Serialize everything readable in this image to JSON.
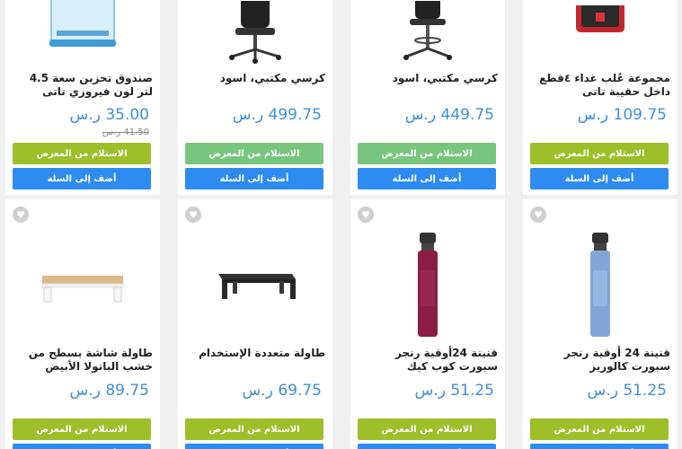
{
  "labels": {
    "pickup": "الاستلام من المعرض",
    "add_to_cart": "أضف إلى السلة"
  },
  "colors": {
    "price": "#3e8fdc",
    "pickup": "#9dbf2a",
    "pickup_alt": "#78c57e",
    "cart": "#2e8bf0",
    "heart": "#cfcfcf"
  },
  "products": [
    {
      "title": "صندوق تخزين سعة 4.5 لتر لون فيروزي تاتى",
      "price": "35.00 ر.س",
      "old_price": "41.50 ر.س",
      "image": "storage-box-image"
    },
    {
      "title": "كرسي مكتبي، اسود",
      "price": "499.75 ر.س",
      "image": "office-chair-image"
    },
    {
      "title": "كرسي مكتبي، اسود",
      "price": "449.75 ر.س",
      "image": "drafting-chair-image"
    },
    {
      "title": "مجموعة عُلب غداء ٤قطع داخل حقيبة تاتى",
      "price": "109.75 ر.س",
      "image": "lunch-bag-image"
    },
    {
      "title": "طاولة شاشة بسطح من خشب الباتولا الأبيض",
      "price": "89.75 ر.س",
      "image": "monitor-stand-wood-image"
    },
    {
      "title": "طاولة متعددة الإستخدام",
      "price": "69.75 ر.س",
      "image": "monitor-stand-black-image"
    },
    {
      "title": "قنينة 24أوقية رنجر سبورت كوب كيك",
      "price": "51.25 ر.س",
      "image": "bottle-red-image"
    },
    {
      "title": "قنينة 24 أوقية رنجر سبورت كالوريز",
      "price": "51.25 ر.س",
      "image": "bottle-blue-image"
    }
  ]
}
